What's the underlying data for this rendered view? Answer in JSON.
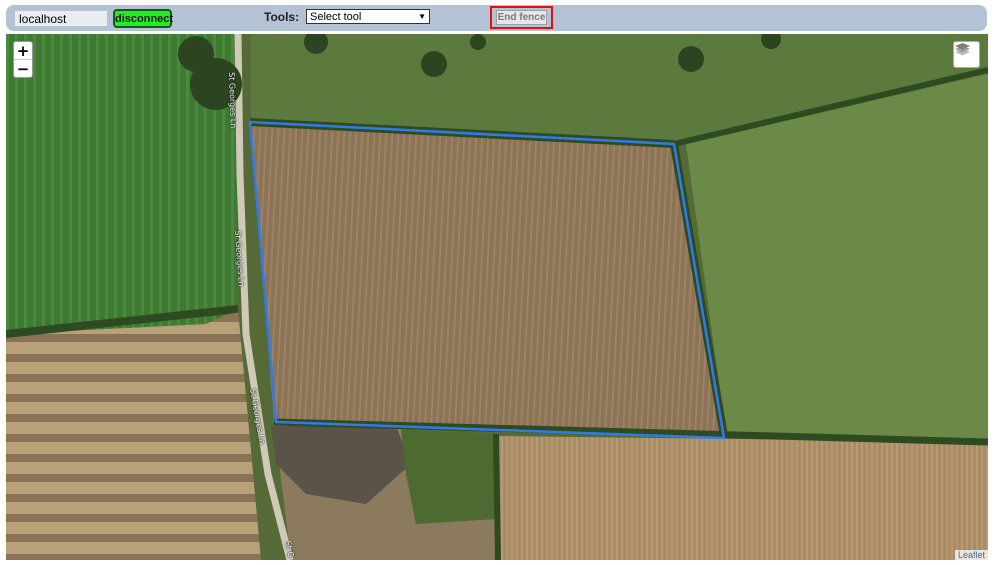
{
  "toolbar": {
    "host_value": "localhost",
    "disconnect_label": "disconnect",
    "tools_label": "Tools:",
    "tool_selected": "Select tool",
    "end_fence_label": "End fence"
  },
  "map": {
    "zoom_in_label": "+",
    "zoom_out_label": "−",
    "attribution": "Leaflet",
    "road_label": "St Georges Ln",
    "road_label_short": "St G",
    "fence_color": "#2f7bea"
  }
}
